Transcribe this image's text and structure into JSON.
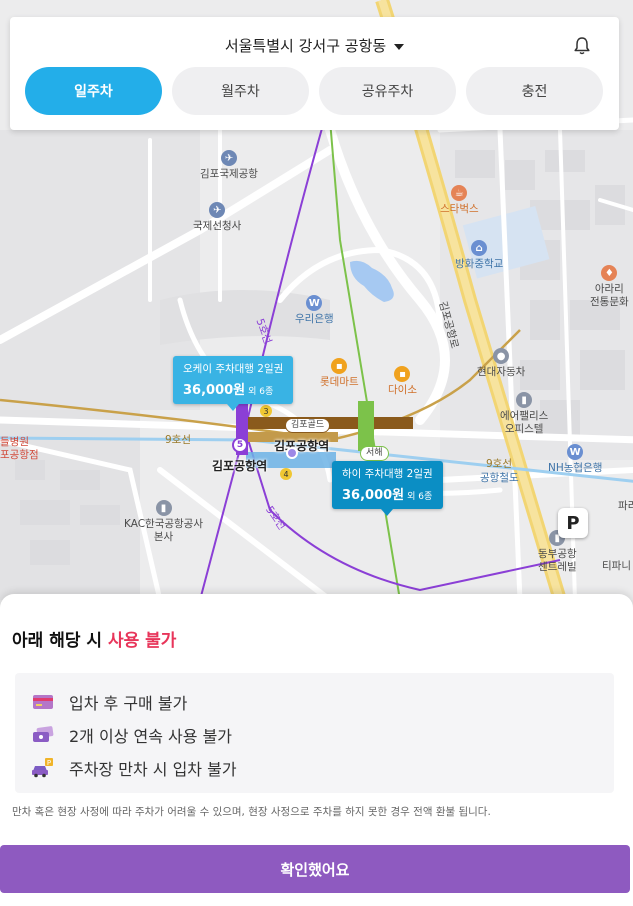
{
  "header": {
    "location": "서울특별시 강서구 공항동",
    "tabs": [
      {
        "label": "일주차",
        "active": true
      },
      {
        "label": "월주차",
        "active": false
      },
      {
        "label": "공유주차",
        "active": false
      },
      {
        "label": "충전",
        "active": false
      }
    ]
  },
  "map": {
    "pois": {
      "gimpo_intl": "김포국제공항",
      "gukje": "국제선청사",
      "woori": "우리은행",
      "lotte": "롯데마트",
      "daiso": "다이소",
      "starbucks": "스타벅스",
      "banghwa": "방화중학교",
      "hyundai": "현대자동차",
      "airpalace_1": "에어팰리스",
      "airpalace_2": "오피스텔",
      "nh": "NH농협은행",
      "kac_1": "KAC한국공항공사",
      "kac_2": "본사",
      "dongbu_1": "동부공항",
      "dongbu_2": "센트레빌",
      "arari_1": "아라리",
      "arari_2": "전통문화",
      "gimpo_road": "김포공항로",
      "hosp_1": "들병원",
      "hosp_2": "포공항점",
      "tipani": "티파니",
      "pa": "파리"
    },
    "stations": {
      "main": "김포공항역",
      "main2": "김포공항역",
      "gold": "김포골드",
      "seohae": "서해",
      "line9": "9호선",
      "line9b": "9호선",
      "line5": "5호선",
      "line5b": "5호선",
      "airport_rail": "공항철도"
    },
    "markers": {
      "line5_no": "5",
      "gold_no": "3",
      "gold_no2": "4"
    },
    "bubbles": [
      {
        "title": "오케이 주차대행 2일권",
        "price": "36,000원",
        "extra": "외 6종"
      },
      {
        "title": "하이 주차대행 2일권",
        "price": "36,000원",
        "extra": "외 6종"
      }
    ],
    "parking_marker": "P"
  },
  "sheet": {
    "title_prefix": "아래 해당 시 ",
    "title_warning": "사용 불가",
    "rules": [
      {
        "icon": "credit-card-icon",
        "text": "입차 후 구매 불가"
      },
      {
        "icon": "tickets-icon",
        "text": "2개 이상 연속 사용 불가"
      },
      {
        "icon": "car-parking-icon",
        "text": "주차장 만차 시 입차 불가"
      }
    ],
    "notice": "만차 혹은 현장 사정에 따라 주차가 어려울 수 있으며, 현장 사정으로 주차를 하지 못한 경우 전액 환불 됩니다.",
    "confirm_label": "확인했어요"
  },
  "colors": {
    "active_tab": "#23aee9",
    "warning": "#e8355a",
    "confirm": "#8e5ac0",
    "bubble_light": "#39b3e4",
    "bubble_dark": "#0b8ec4"
  }
}
